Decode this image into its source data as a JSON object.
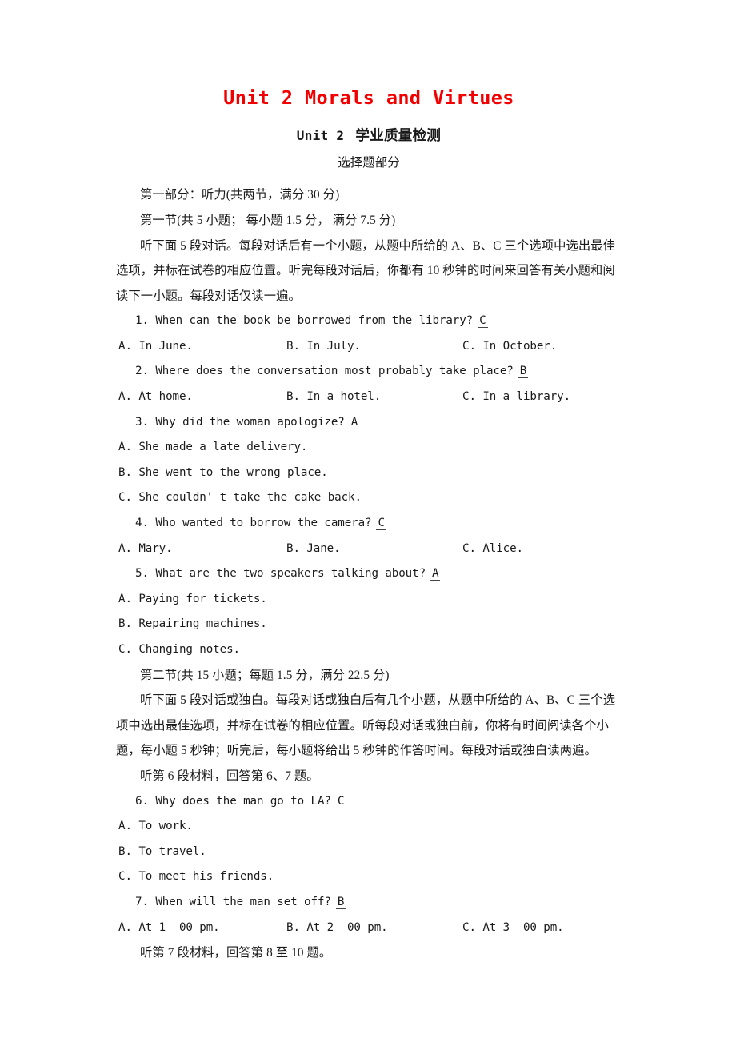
{
  "document": {
    "main_title": "Unit 2 Morals and Virtues",
    "title_color": "#f20000",
    "sub_title_en": "Unit 2",
    "sub_title_cn": "学业质量检测",
    "section_label": "选择题部分"
  },
  "part_one": {
    "heading": "第一部分：听力(共两节，满分 30 分)",
    "section_one_heading": "第一节(共 5 小题； 每小题 1.5 分， 满分 7.5 分)",
    "instructions": [
      "听下面 5 段对话。每段对话后有一个小题，从题中所给的 A、B、C 三个选项中选出最佳",
      "选项，并标在试卷的相应位置。听完每段对话后，你都有 10 秒钟的时间来回答有关小题和阅",
      "读下一小题。每段对话仅读一遍。"
    ],
    "section_two_heading": "第二节(共 15 小题；每题 1.5 分，满分 22.5 分)",
    "section_two_instructions": [
      "听下面 5 段对话或独白。每段对话或独白后有几个小题，从题中所给的 A、B、C 三个选",
      "项中选出最佳选项，并标在试卷的相应位置。听每段对话或独白前，你将有时间阅读各个小",
      "题，每小题 5 秒钟；听完后，每小题将给出 5 秒钟的作答时间。每段对话或独白读两遍。"
    ],
    "material_six": "听第 6 段材料，回答第 6、7 题。",
    "material_seven": "听第 7 段材料，回答第 8 至 10 题。"
  },
  "questions": [
    {
      "number": "1.",
      "stem": "When can the book be borrowed from the library?",
      "answer": "C",
      "options_inline": [
        "A. In June.",
        "B. In July.",
        "C. In October."
      ]
    },
    {
      "number": "2.",
      "stem": "Where does the conversation most probably take place?",
      "answer": "B",
      "options_inline": [
        "A. At home.",
        "B. In a hotel.",
        "C. In a library."
      ]
    },
    {
      "number": "3.",
      "stem": "Why did the woman apologize?",
      "answer": "A",
      "options_stacked": [
        "A. She made a late delivery.",
        "B. She went to the wrong place.",
        "C. She couldn' t take the cake back."
      ]
    },
    {
      "number": "4.",
      "stem": "Who wanted to borrow the camera?",
      "answer": "C",
      "options_inline": [
        "A. Mary.",
        "B. Jane.",
        "C. Alice."
      ]
    },
    {
      "number": "5.",
      "stem": "What are the two speakers talking about?",
      "answer": "A",
      "options_stacked": [
        "A. Paying for tickets.",
        "B. Repairing machines.",
        "C. Changing notes."
      ]
    },
    {
      "number": "6.",
      "stem": "Why does the man go to LA?",
      "answer": "C",
      "options_stacked": [
        "A. To work.",
        "B. To travel.",
        "C. To meet his friends."
      ]
    },
    {
      "number": "7.",
      "stem": "When will the man set off?",
      "answer": "B",
      "options_inline": [
        "A. At 1  00 pm.",
        "B. At 2  00 pm.",
        "C. At 3  00 pm."
      ]
    }
  ]
}
